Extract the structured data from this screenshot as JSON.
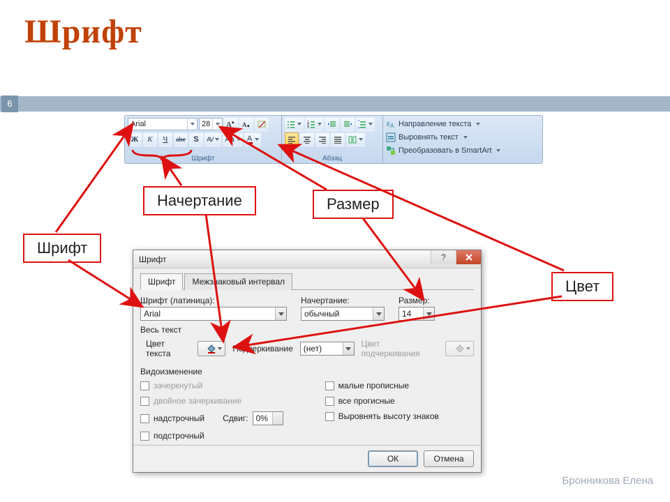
{
  "slide": {
    "title": "Шрифт",
    "page_number": "6",
    "author": "Бронникова Елена"
  },
  "callouts": {
    "font": "Шрифт",
    "style": "Начертание",
    "size": "Размер",
    "color": "Цвет"
  },
  "ribbon": {
    "font_group_caption": "Шрифт",
    "para_group_caption": "Абзац",
    "font_name": "Arial",
    "font_size": "28",
    "bold": "Ж",
    "italic": "К",
    "underline": "Ч",
    "strike": "abe",
    "shadow": "S",
    "spacing": "AV",
    "changecase": "Aa",
    "fontcolor": "A",
    "cmd_text_direction": "Направление текста",
    "cmd_align_text": "Выровнять текст",
    "cmd_smartart": "Преобразовать в SmartArt"
  },
  "dialog": {
    "title": "Шрифт",
    "tab_font": "Шрифт",
    "tab_spacing": "Межзнаковый интервал",
    "label_font": "Шрифт (латиница):",
    "value_font": "Arial",
    "label_style": "Начертание:",
    "value_style": "обычный",
    "label_size": "Размер:",
    "value_size": "14",
    "section_all_text": "Весь текст",
    "label_text_color": "Цвет текста",
    "label_underline": "Подчеркивание",
    "value_underline": "(нет)",
    "label_underline_color": "Цвет подчеркивания",
    "section_effects": "Видоизменение",
    "chk_strike": "зачеркнутый",
    "chk_dblstrike": "двойное зачеркивание",
    "chk_super": "надстрочный",
    "chk_sub": "подстрочный",
    "label_offset": "Сдвиг:",
    "value_offset": "0%",
    "chk_smallcaps": "малые прописные",
    "chk_allcaps": "все прогисные",
    "chk_equalize": "Выровнять высоту знаков",
    "btn_ok": "ОК",
    "btn_cancel": "Отмена"
  }
}
